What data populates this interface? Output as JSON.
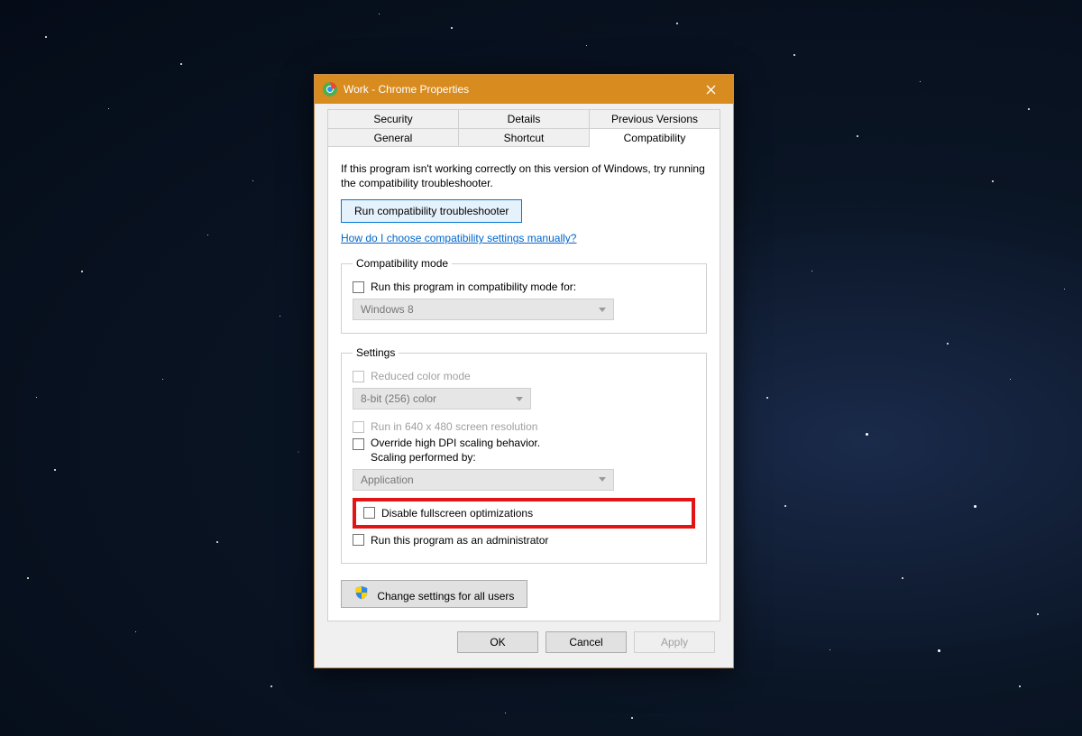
{
  "title": "Work - Chrome Properties",
  "tabs": {
    "row1": [
      "Security",
      "Details",
      "Previous Versions"
    ],
    "row2": [
      "General",
      "Shortcut",
      "Compatibility"
    ]
  },
  "intro": "If this program isn't working correctly on this version of Windows, try running the compatibility troubleshooter.",
  "troubleshooter_btn": "Run compatibility troubleshooter",
  "manual_link": "How do I choose compatibility settings manually?",
  "compat_mode": {
    "legend": "Compatibility mode",
    "checkbox": "Run this program in compatibility mode for:",
    "select": "Windows 8"
  },
  "settings": {
    "legend": "Settings",
    "reduced_color": "Reduced color mode",
    "color_select": "8-bit (256) color",
    "low_res": "Run in 640 x 480 screen resolution",
    "dpi_line1": "Override high DPI scaling behavior.",
    "dpi_line2": "Scaling performed by:",
    "dpi_select": "Application",
    "disable_fs": "Disable fullscreen optimizations",
    "run_admin": "Run this program as an administrator"
  },
  "change_all": "Change settings for all users",
  "buttons": {
    "ok": "OK",
    "cancel": "Cancel",
    "apply": "Apply"
  }
}
